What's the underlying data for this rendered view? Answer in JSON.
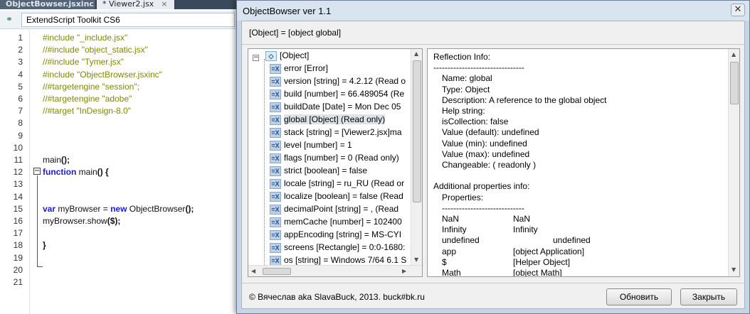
{
  "editor": {
    "tabs": [
      {
        "label": "ObjectBowser.jsxinc"
      },
      {
        "label": "* Viewer2.jsx",
        "close": "×"
      }
    ],
    "target": {
      "label": "ExtendScript Toolkit CS6"
    },
    "line_numbers": [
      "1",
      "2",
      "3",
      "4",
      "5",
      "6",
      "7",
      "8",
      "9",
      "10",
      "11",
      "12",
      "13",
      "14",
      "15",
      "16",
      "17",
      "18",
      "19",
      "20",
      "21"
    ],
    "code_lines": [
      {
        "n": 1,
        "parts": [
          {
            "t": "#include \"_include.jsx\"",
            "c": "cm"
          }
        ]
      },
      {
        "n": 2,
        "parts": [
          {
            "t": "//#include \"object_static.jsx\"",
            "c": "cm"
          }
        ]
      },
      {
        "n": 3,
        "parts": [
          {
            "t": "//#include \"Tymer.jsx\"",
            "c": "cm"
          }
        ]
      },
      {
        "n": 4,
        "parts": [
          {
            "t": "#include \"ObjectBrowser.jsxinc\"",
            "c": "cm"
          }
        ]
      },
      {
        "n": 5,
        "parts": [
          {
            "t": "//#targetengine \"session\";",
            "c": "cm"
          }
        ]
      },
      {
        "n": 6,
        "parts": [
          {
            "t": "//#targetengine \"adobe\"",
            "c": "cm"
          }
        ]
      },
      {
        "n": 7,
        "parts": [
          {
            "t": "//#target \"InDesign-8.0\"",
            "c": "cm"
          }
        ]
      },
      {
        "n": 11,
        "parts": [
          {
            "t": "main",
            "c": "pl"
          },
          {
            "t": "();",
            "c": "pl bold"
          }
        ]
      },
      {
        "n": 12,
        "parts": [
          {
            "t": "function",
            "c": "kw"
          },
          {
            "t": " main",
            "c": "pl"
          },
          {
            "t": "() {",
            "c": "pl bold"
          }
        ]
      },
      {
        "n": 15,
        "parts": [
          {
            "t": "    var",
            "c": "kw"
          },
          {
            "t": " myBrowser ",
            "c": "pl"
          },
          {
            "t": "=",
            "c": "pl"
          },
          {
            "t": " new",
            "c": "kw"
          },
          {
            "t": " ObjectBrowser",
            "c": "pl"
          },
          {
            "t": "();",
            "c": "pl bold"
          }
        ]
      },
      {
        "n": 16,
        "parts": [
          {
            "t": "    myBrowser.show",
            "c": "pl"
          },
          {
            "t": "($);",
            "c": "pl bold"
          }
        ]
      },
      {
        "n": 18,
        "parts": [
          {
            "t": "}",
            "c": "pl bold"
          }
        ]
      }
    ]
  },
  "dialog": {
    "title": "ObjectBowser ver 1.1",
    "close_glyph": "✕",
    "path": "[Object] = [object global]",
    "tree": {
      "root": {
        "expander": "−",
        "label": "[Object]"
      },
      "items": [
        {
          "icon": "=X",
          "label": "error [Error]"
        },
        {
          "icon": "=X",
          "label": "version [string] = 4.2.12 (Read o"
        },
        {
          "icon": "=X",
          "label": "build [number] = 66.489054 (Re"
        },
        {
          "icon": "=X",
          "label": "buildDate [Date] = Mon Dec 05"
        },
        {
          "icon": "=X",
          "label": "global [Object] (Read only)",
          "selected": true
        },
        {
          "icon": "=X",
          "label": "stack [string] = [Viewer2.jsx]ma"
        },
        {
          "icon": "=X",
          "label": "level [number] = 1"
        },
        {
          "icon": "=X",
          "label": "flags [number] = 0 (Read only)"
        },
        {
          "icon": "=X",
          "label": "strict [boolean] = false"
        },
        {
          "icon": "=X",
          "label": "locale [string] = ru_RU (Read or"
        },
        {
          "icon": "=X",
          "label": "localize [boolean] = false (Read"
        },
        {
          "icon": "=X",
          "label": "decimalPoint [string] = , (Read"
        },
        {
          "icon": "=X",
          "label": "memCache [number] = 102400"
        },
        {
          "icon": "=X",
          "label": "appEncoding [string] = MS-CYI"
        },
        {
          "icon": "=X",
          "label": "screens [Rectangle] = 0:0-1680:"
        },
        {
          "icon": "=X",
          "label": "os [string] = Windows 7/64 6.1 S"
        }
      ]
    },
    "info": {
      "lines": [
        {
          "indent": 0,
          "text": "Reflection Info:"
        },
        {
          "indent": 0,
          "text": "--------------------------------"
        },
        {
          "indent": 1,
          "text": "Name: global"
        },
        {
          "indent": 1,
          "text": "Type: Object"
        },
        {
          "indent": 1,
          "text": "Description: A reference to the global object"
        },
        {
          "indent": 1,
          "text": "Help string:"
        },
        {
          "indent": 1,
          "text": "isCollection: false"
        },
        {
          "indent": 1,
          "text": "Value (default): undefined"
        },
        {
          "indent": 1,
          "text": "Value (min): undefined"
        },
        {
          "indent": 1,
          "text": "Value (max): undefined"
        },
        {
          "indent": 1,
          "text": "Changeable: ( readonly )"
        },
        {
          "indent": 0,
          "text": ""
        },
        {
          "indent": 0,
          "text": "Additional properties info:"
        },
        {
          "indent": 1,
          "text": "Properties:"
        },
        {
          "indent": 1,
          "text": "-----------------------------"
        }
      ],
      "props": [
        {
          "k": "NaN",
          "v": "NaN"
        },
        {
          "k": "Infinity",
          "v": "Infinity"
        },
        {
          "k": "undefined",
          "v": "undefined",
          "wide": true
        },
        {
          "k": "app",
          "v": "[object Application]"
        },
        {
          "k": "$",
          "v": "[Helper Object]"
        },
        {
          "k": "Math",
          "v": "[object Math]"
        }
      ]
    },
    "footer": "© Вячеслав aka SlavaBuck, 2013.  buck#bk.ru",
    "buttons": {
      "refresh": "Обновить",
      "close": "Закрыть"
    }
  }
}
